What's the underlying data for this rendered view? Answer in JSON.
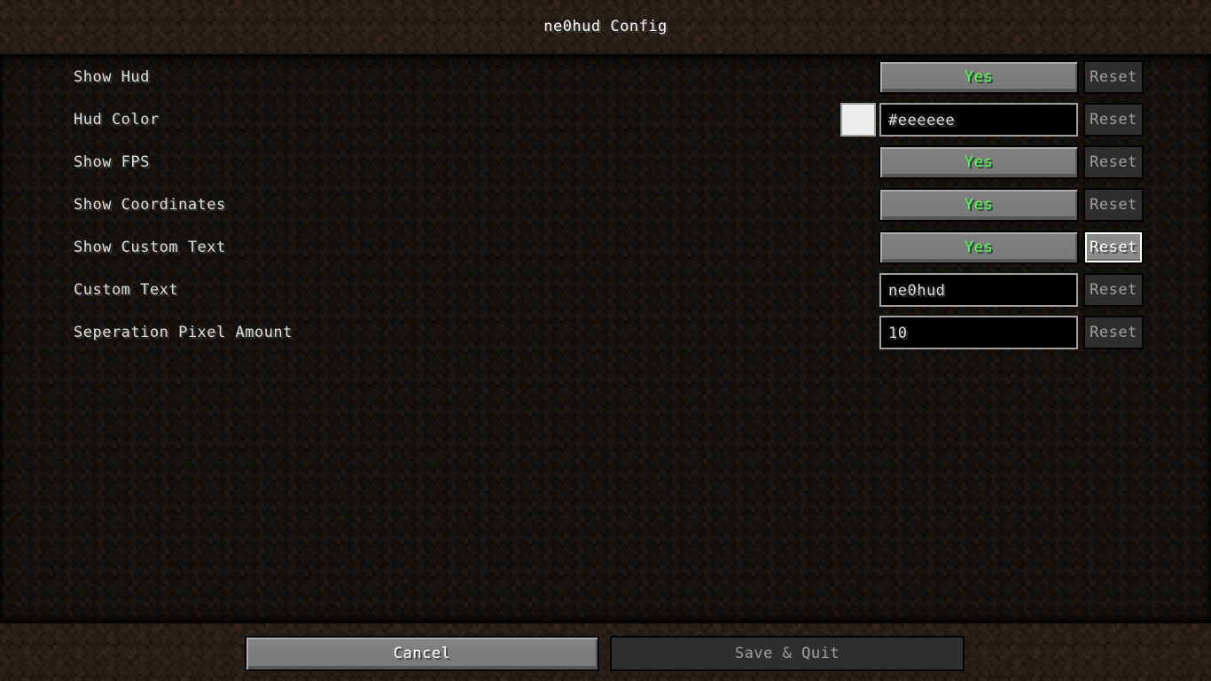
{
  "header": {
    "title": "ne0hud Config"
  },
  "options": [
    {
      "label": "Show Hud",
      "type": "toggle",
      "value": "Yes",
      "reset": "Reset",
      "reset_state": "disabled"
    },
    {
      "label": "Hud Color",
      "type": "color",
      "value": "#eeeeee",
      "swatch_color": "#eeeeee",
      "reset": "Reset",
      "reset_state": "disabled"
    },
    {
      "label": "Show FPS",
      "type": "toggle",
      "value": "Yes",
      "reset": "Reset",
      "reset_state": "disabled"
    },
    {
      "label": "Show Coordinates",
      "type": "toggle",
      "value": "Yes",
      "reset": "Reset",
      "reset_state": "disabled"
    },
    {
      "label": "Show Custom Text",
      "type": "toggle",
      "value": "Yes",
      "reset": "Reset",
      "reset_state": "hovered"
    },
    {
      "label": "Custom Text",
      "type": "text",
      "value": "ne0hud",
      "reset": "Reset",
      "reset_state": "disabled"
    },
    {
      "label": "Seperation Pixel Amount",
      "type": "number",
      "value": "10",
      "reset": "Reset",
      "reset_state": "disabled"
    }
  ],
  "footer": {
    "cancel_label": "Cancel",
    "save_label": "Save & Quit",
    "save_state": "disabled"
  },
  "colors": {
    "toggle_on_text": "#55ff55",
    "label_text": "#e0e0e0"
  }
}
